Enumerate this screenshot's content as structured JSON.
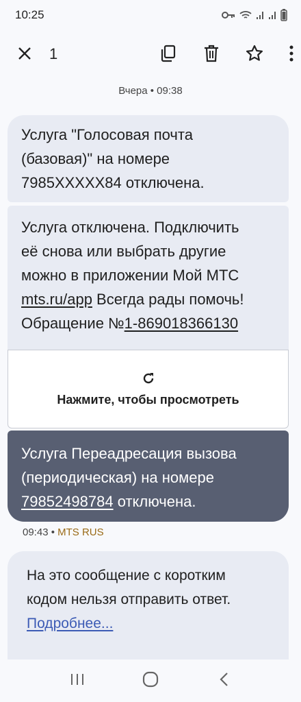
{
  "status_bar": {
    "time": "10:25",
    "icons": [
      "key-icon",
      "wifi-icon",
      "signal-icon",
      "signal-icon",
      "battery-icon"
    ]
  },
  "app_bar": {
    "selected_count": "1",
    "icons": [
      "close-icon",
      "copy-icon",
      "delete-icon",
      "star-icon",
      "more-icon"
    ]
  },
  "thread": {
    "date_label": "Вчера • 09:38",
    "message_1": {
      "line_1": "Услуга \"Голосовая почта",
      "line_2": "(базовая)\" на номере",
      "line_3": "7985XXXXX84 отключена."
    },
    "message_2": {
      "line_1": "Услуга отключена. Подключить",
      "line_2": "её снова или выбрать другие",
      "line_3": "можно в приложении Мой МТС",
      "link": "mts.ru/app",
      "line_4_rest": " Всегда рады помочь!",
      "line_5_prefix": "Обращение №",
      "line_5_number": "1-869018366130"
    },
    "preview": {
      "icon": "refresh-icon",
      "label": "Нажмите, чтобы просмотреть"
    },
    "message_3": {
      "line_1": "Услуга Переадресация вызова",
      "line_2": "(периодическая) на номере",
      "phone": "79852498784",
      "line_3_rest": " отключена."
    },
    "meta": {
      "time": "09:43",
      "separator": " • ",
      "sender": "MTS RUS"
    },
    "info": {
      "line_1": "На это сообщение с коротким",
      "line_2": "кодом нельзя отправить ответ.",
      "link": "Подробнее..."
    }
  },
  "nav_bar": {
    "icons": [
      "recents-icon",
      "home-icon",
      "back-icon"
    ]
  }
}
